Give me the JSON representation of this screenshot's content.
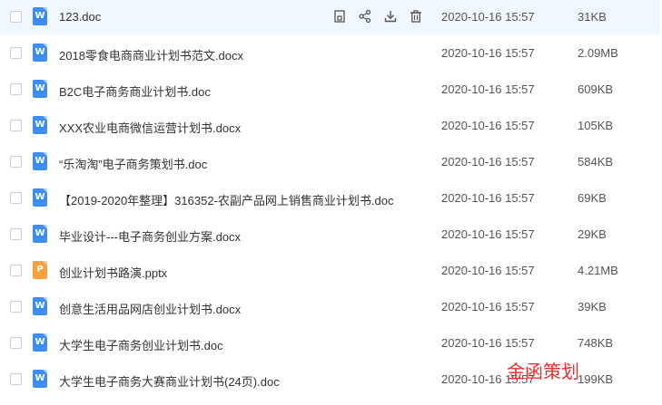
{
  "files": [
    {
      "name": "123.doc",
      "type": "word",
      "icon_letter": "W",
      "date": "2020-10-16 15:57",
      "size": "31KB",
      "selected": true
    },
    {
      "name": "2018零食电商商业计划书范文.docx",
      "type": "word",
      "icon_letter": "W",
      "date": "2020-10-16 15:57",
      "size": "2.09MB"
    },
    {
      "name": "B2C电子商务商业计划书.doc",
      "type": "word",
      "icon_letter": "W",
      "date": "2020-10-16 15:57",
      "size": "609KB"
    },
    {
      "name": "XXX农业电商微信运营计划书.docx",
      "type": "word",
      "icon_letter": "W",
      "date": "2020-10-16 15:57",
      "size": "105KB"
    },
    {
      "name": "“乐淘淘”电子商务策划书.doc",
      "type": "word",
      "icon_letter": "W",
      "date": "2020-10-16 15:57",
      "size": "584KB"
    },
    {
      "name": "【2019-2020年整理】316352-农副产品网上销售商业计划书.doc",
      "type": "word",
      "icon_letter": "W",
      "date": "2020-10-16 15:57",
      "size": "69KB"
    },
    {
      "name": "毕业设计---电子商务创业方案.docx",
      "type": "word",
      "icon_letter": "W",
      "date": "2020-10-16 15:57",
      "size": "29KB"
    },
    {
      "name": "创业计划书路演.pptx",
      "type": "ppt",
      "icon_letter": "P",
      "date": "2020-10-16 15:57",
      "size": "4.21MB"
    },
    {
      "name": "创意生活用品网店创业计划书.docx",
      "type": "word",
      "icon_letter": "W",
      "date": "2020-10-16 15:57",
      "size": "39KB"
    },
    {
      "name": "大学生电子商务创业计划书.doc",
      "type": "word",
      "icon_letter": "W",
      "date": "2020-10-16 15:57",
      "size": "748KB"
    },
    {
      "name": "大学生电子商务大赛商业计划书(24页).doc",
      "type": "word",
      "icon_letter": "W",
      "date": "2020-10-16 15:57",
      "size": "199KB"
    }
  ],
  "row_actions": [
    "save-icon",
    "share-icon",
    "download-icon",
    "delete-icon"
  ],
  "watermark": "金函策划",
  "colors": {
    "word_icon": "#3b8ef0",
    "ppt_icon": "#f5a03a",
    "selected_row": "#f0f7ff",
    "watermark": "#e8302c"
  }
}
